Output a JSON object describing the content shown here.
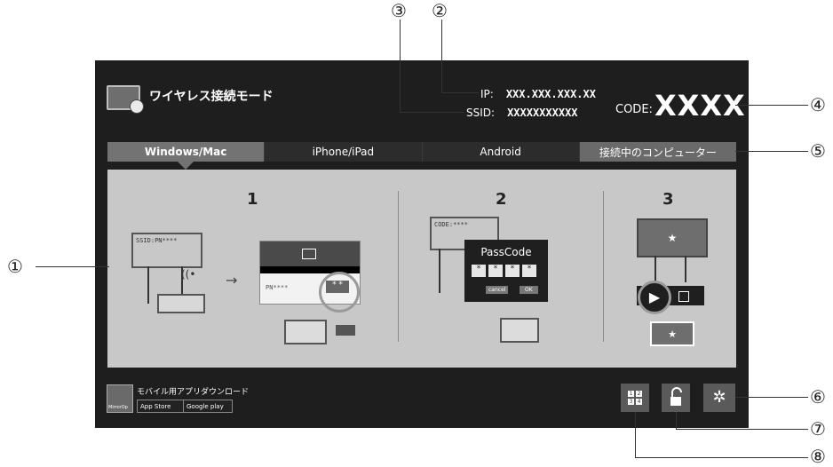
{
  "header": {
    "mode_title": "ワイヤレス接続モード",
    "ip_label": "IP:",
    "ip_value": "XXX.XXX.XXX.XX",
    "ssid_label": "SSID:",
    "ssid_value": "XXXXXXXXXXX",
    "code_label": "CODE:",
    "code_value": "XXXX"
  },
  "tabs": [
    "Windows/Mac",
    "iPhone/iPad",
    "Android",
    "接続中のコンピューター"
  ],
  "steps": [
    "1",
    "2",
    "3"
  ],
  "step1": {
    "ssid_text": "SSID:PN****",
    "pn_text": "PN****",
    "stars": "* *"
  },
  "step2": {
    "code_text": "CODE:****",
    "passcode_title": "PassCode",
    "digits": [
      "*",
      "*",
      "*",
      "*"
    ],
    "cancel": "cancel",
    "ok": "OK"
  },
  "step3": {
    "star": "★"
  },
  "footer": {
    "mobile_label": "モバイル用アプリダウンロード",
    "mirrorop": "MirrorOp",
    "appstore": "App Store",
    "googleplay": "Google play"
  },
  "buttons": {
    "grid": [
      "1",
      "2",
      "3",
      "4"
    ]
  },
  "callouts": [
    "①",
    "②",
    "③",
    "④",
    "⑤",
    "⑥",
    "⑦",
    "⑧"
  ],
  "arrow": "→"
}
